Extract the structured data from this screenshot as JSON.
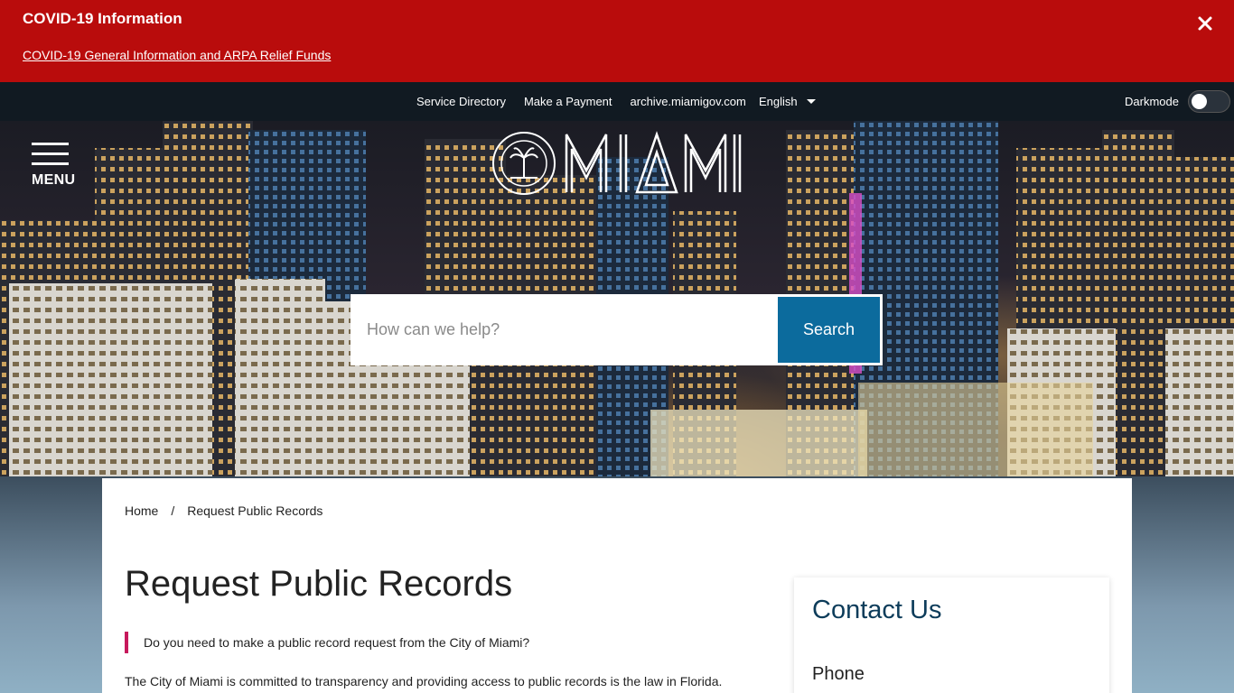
{
  "alert": {
    "title": "COVID-19 Information",
    "link_text": "COVID-19 General Information and ARPA Relief Funds",
    "close_icon": "close-icon"
  },
  "utility_bar": {
    "links": [
      "Service Directory",
      "Make a Payment",
      "archive.miamigov.com"
    ],
    "language": "English",
    "darkmode_label": "Darkmode",
    "darkmode_on": false
  },
  "header": {
    "menu_label": "MENU",
    "logo_text": "MIAMI",
    "seal_text": "THE CITY OF MIAMI FLORIDA"
  },
  "search": {
    "placeholder": "How can we help?",
    "button_label": "Search"
  },
  "breadcrumb": {
    "home": "Home",
    "separator": "/",
    "current": "Request Public Records"
  },
  "main": {
    "title": "Request Public Records",
    "lead": "Do you need to make a public record request from the City of Miami?",
    "body": "The City of Miami is committed to transparency and providing access to public records is the law in Florida."
  },
  "sidebar": {
    "contact_title": "Contact Us",
    "phone_label": "Phone"
  },
  "colors": {
    "alert_bg": "#b90c0c",
    "utility_bg": "#111a22",
    "search_button": "#0c6b9d",
    "lead_accent": "#c7195c",
    "contact_title": "#0d3c5a"
  }
}
